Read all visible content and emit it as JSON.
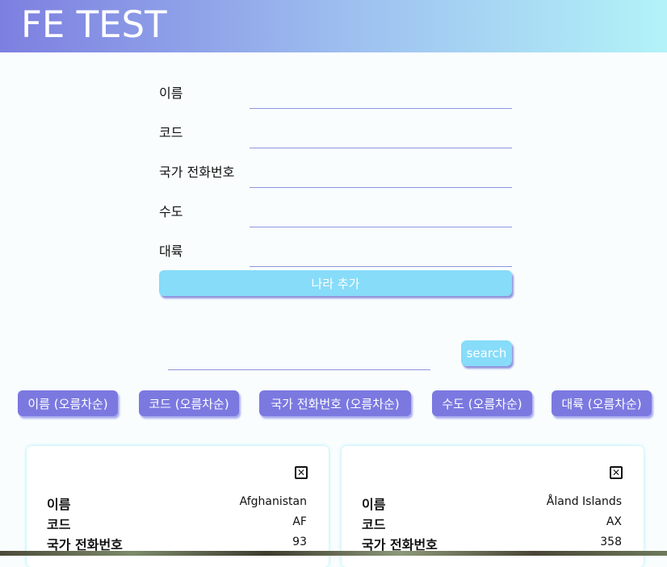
{
  "header": {
    "title": "FE TEST"
  },
  "form": {
    "fields": [
      {
        "label": "이름",
        "value": ""
      },
      {
        "label": "코드",
        "value": ""
      },
      {
        "label": "국가 전화번호",
        "value": ""
      },
      {
        "label": "수도",
        "value": ""
      },
      {
        "label": "대륙",
        "value": ""
      }
    ],
    "submit_label": "나라 추가"
  },
  "search": {
    "value": "",
    "button_label": "search"
  },
  "sort_buttons": [
    "이름 (오름차순)",
    "코드 (오름차순)",
    "국가 전화번호 (오름차순)",
    "수도 (오름차순)",
    "대륙 (오름차순)"
  ],
  "cards": [
    {
      "close_icon": "close-icon",
      "rows": [
        {
          "key": "이름",
          "value": "Afghanistan"
        },
        {
          "key": "코드",
          "value": "AF"
        },
        {
          "key": "국가 전화번호",
          "value": "93"
        }
      ]
    },
    {
      "close_icon": "close-icon",
      "rows": [
        {
          "key": "이름",
          "value": "Åland Islands"
        },
        {
          "key": "코드",
          "value": "AX"
        },
        {
          "key": "국가 전화번호",
          "value": "358"
        }
      ]
    }
  ],
  "colors": {
    "header_start": "#7d7fe0",
    "header_end": "#b2f3f8",
    "primary_button": "#87dcf9",
    "sort_button": "#7b79e0"
  }
}
